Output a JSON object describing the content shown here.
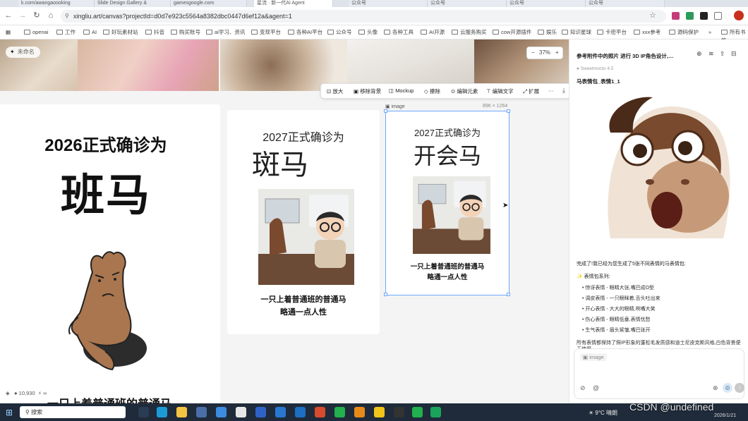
{
  "browser": {
    "tabs": [
      "k.com/awangaoooking",
      "Slide Design Gallery &",
      "gamesgoogle.com",
      "星流 · 新一代AI Agent",
      "公众号",
      "公众号",
      "公众号",
      "公众号",
      "所有书签"
    ],
    "url": "xingliu.art/canvas?projectId=d0d7e923c5564a8382dbc0447d6ef12a&agent=1",
    "bookmarks": [
      "openai",
      "工作",
      "AI",
      "好玩素材站",
      "抖音",
      "购买账号",
      "ai学习、资讯",
      "变现平台",
      "各种AI平台",
      "公众号",
      "头像",
      "各种工具",
      "AI开源",
      "云服务购买",
      "cow开源插件",
      "娱乐",
      "知识星球",
      "卡密平台",
      "xxx参考",
      "源码保护"
    ],
    "all_bookmarks": "所有书签"
  },
  "canvas": {
    "project_name": "未命名",
    "zoom": "37%",
    "left_card": {
      "line1": "2026正式确诊为",
      "line2": "班马",
      "line3": "一只上着普通班的普通马"
    },
    "mid_card": {
      "line1": "2027正式确诊为",
      "line2": "斑马",
      "caption1": "一只上着普通班的普通马",
      "caption2": "略通一点人性"
    },
    "sel_card": {
      "line1": "2027正式确诊为",
      "line2": "开会马",
      "caption1": "一只上着普通班的普通马",
      "caption2": "略通一点人性"
    },
    "selection_label": "image",
    "selection_size": "896 × 1264",
    "toolbar": [
      "放大",
      "移除背景",
      "Mockup",
      "擦除",
      "编辑元素",
      "编辑文字",
      "扩展",
      "···"
    ],
    "status_count": "10,930",
    "status_inf": "∞"
  },
  "panel": {
    "title": "参考附件中的照片 进行 3D IP角色设计,…",
    "agent": "Sweetmocto 4.5",
    "prompt": "马表情包_表情1_1",
    "done": "完成了!我已经为您生成了5张不同表情的马表情包:",
    "series_title": "表情包系列:",
    "items": [
      "惊讶表情 - 眼睛大张,嘴巴成O型",
      "调皮表情 - 一只眼眯着,舌头吐出来",
      "开心表情 - 大大的眼睛,咧嘴大笑",
      "伤心表情 - 眼睛低垂,表情忧愁",
      "生气表情 - 眉头紧皱,嘴巴张开"
    ],
    "summary": "所有表情都保持了照IP形象的蓬松毛发质感和迪士尼皮克斯风格,白色背景便于使用。",
    "input_placeholder": "image"
  },
  "taskbar": {
    "search": "搜索",
    "weather": "9°C 晴朗",
    "time": "2026/1/21",
    "watermark": "CSDN @undefined"
  }
}
